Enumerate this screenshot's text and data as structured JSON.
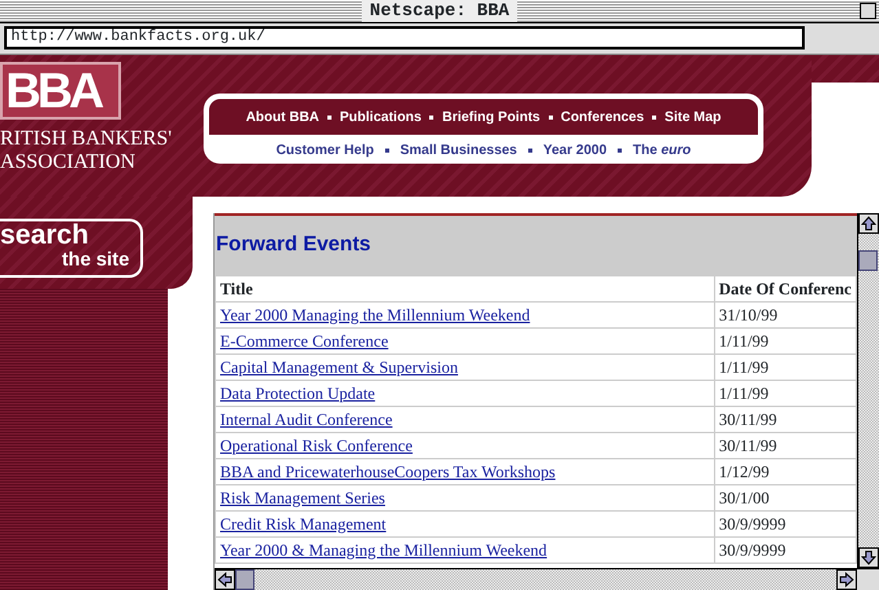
{
  "window": {
    "title": "Netscape: BBA"
  },
  "address_bar": {
    "value": "http://www.bankfacts.org.uk/"
  },
  "logo": {
    "text": "BBA",
    "org_lines": [
      "RITISH BANKERS'",
      "ASSOCIATION"
    ]
  },
  "nav_primary": [
    "About BBA",
    "Publications",
    "Briefing Points",
    "Conferences",
    "Site Map"
  ],
  "nav_secondary": [
    "Customer Help",
    "Small Businesses",
    "Year 2000",
    "The *euro*"
  ],
  "search": {
    "line1": "search",
    "line2": "the site"
  },
  "events": {
    "heading": "Forward Events",
    "columns": [
      "Title",
      "Date Of Conferenc"
    ],
    "rows": [
      {
        "title": "Year 2000 Managing the Millennium Weekend ",
        "date": "31/10/99"
      },
      {
        "title": "E-Commerce Conference",
        "date": "1/11/99"
      },
      {
        "title": "Capital Management & Supervision",
        "date": "1/11/99"
      },
      {
        "title": "Data Protection Update",
        "date": "1/11/99"
      },
      {
        "title": "Internal Audit Conference",
        "date": "30/11/99"
      },
      {
        "title": "Operational Risk Conference",
        "date": "30/11/99"
      },
      {
        "title": "BBA and PricewaterhouseCoopers Tax Workshops",
        "date": "1/12/99"
      },
      {
        "title": "Risk Management Series",
        "date": "30/1/00"
      },
      {
        "title": "Credit Risk Management",
        "date": "30/9/9999"
      },
      {
        "title": "Year 2000 & Managing the Millennium Weekend",
        "date": "30/9/9999"
      }
    ]
  }
}
